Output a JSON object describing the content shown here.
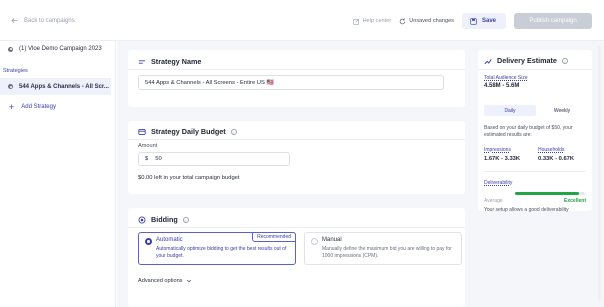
{
  "header": {
    "back_label": "Back to campaigns",
    "help_label": "Help center",
    "unsaved_label": "Unsaved changes",
    "save_label": "Save",
    "publish_label": "Publish campaign"
  },
  "sidebar": {
    "campaign_name": "(1) Vloe Demo Campaign 2023",
    "strategies_heading": "Strategies",
    "strategy_item": "544 Apps & Channels - All Scr...",
    "add_strategy_label": "Add Strategy"
  },
  "strategy_name": {
    "title": "Strategy Name",
    "value": "544 Apps & Channels - All Screens - Entire US 🇺🇸"
  },
  "daily_budget": {
    "title": "Strategy Daily Budget",
    "amount_label": "Amount",
    "currency": "$",
    "amount_value": "50",
    "left_text": "$0.00 left in your total campaign budget"
  },
  "bidding": {
    "title": "Bidding",
    "recommended_badge": "Recommended",
    "options": [
      {
        "title": "Automatic",
        "description": "Automatically optimize bidding to get the best results out of your budget.",
        "selected": true
      },
      {
        "title": "Manual",
        "description": "Manually define the maximum bid you are willing to pay for 1000 impressions (CPM).",
        "selected": false
      }
    ],
    "advanced_label": "Advanced options"
  },
  "estimate": {
    "title": "Delivery Estimate",
    "audience_label": "Total Audience Size",
    "audience_value": "4.58M - 5.6M",
    "toggle": [
      "Daily",
      "Weekly"
    ],
    "toggle_selected": "Daily",
    "description": "Based on your daily budget of $50, your estimated results are:",
    "impressions_label": "Impressions",
    "impressions_value": "1.67K - 3.33K",
    "households_label": "Households",
    "households_value": "0.33K - 0.67K",
    "deliverability_label": "Deliverability",
    "deliverability_fraction": 0.92,
    "deliverability_low": "Average",
    "deliverability_high": "Excellent",
    "deliverability_message": "Your setup allows a good deliverability"
  },
  "colors": {
    "accent": "#3a3fa8",
    "accent_light": "#eef0fb",
    "success": "#23a447",
    "background": "#f5f6f9"
  },
  "icons": [
    "arrow-left-icon",
    "edit-icon",
    "refresh-icon",
    "save-icon",
    "circle-dot-icon",
    "plus-icon",
    "strategy-lines-icon",
    "budget-icon",
    "bidding-icon",
    "info-icon",
    "delivery-icon",
    "chevron-down-icon"
  ]
}
